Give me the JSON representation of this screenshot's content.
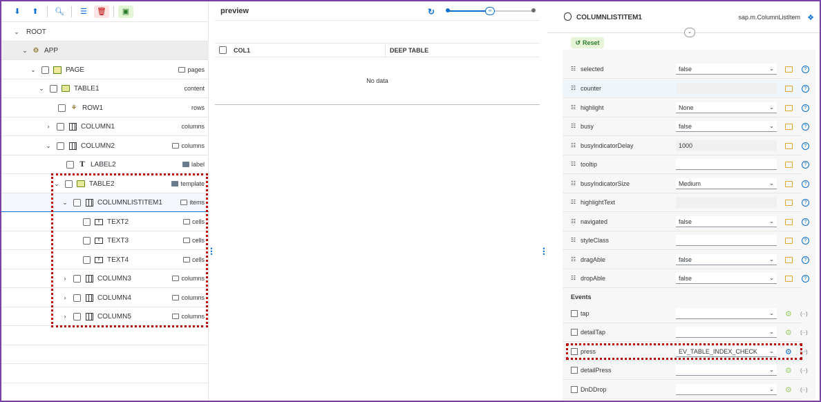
{
  "toolbar": {
    "icons": [
      "expand-all-icon",
      "collapse-all-icon",
      "search-icon",
      "tree-view-icon",
      "delete-icon",
      "add-screen-icon"
    ]
  },
  "tree": {
    "rows": [
      {
        "label": "ROOT",
        "agg": ""
      },
      {
        "label": "APP",
        "agg": ""
      },
      {
        "label": "PAGE",
        "agg": "pages"
      },
      {
        "label": "TABLE1",
        "agg": "content"
      },
      {
        "label": "ROW1",
        "agg": "rows"
      },
      {
        "label": "COLUMN1",
        "agg": "columns"
      },
      {
        "label": "COLUMN2",
        "agg": "columns"
      },
      {
        "label": "LABEL2",
        "agg": "label"
      },
      {
        "label": "TABLE2",
        "agg": "template"
      },
      {
        "label": "COLUMNLISTITEM1",
        "agg": "items"
      },
      {
        "label": "TEXT2",
        "agg": "cells"
      },
      {
        "label": "TEXT3",
        "agg": "cells"
      },
      {
        "label": "TEXT4",
        "agg": "cells"
      },
      {
        "label": "COLUMN3",
        "agg": "columns"
      },
      {
        "label": "COLUMN4",
        "agg": "columns"
      },
      {
        "label": "COLUMN5",
        "agg": "columns"
      }
    ]
  },
  "preview": {
    "title": "preview",
    "col1": "COL1",
    "col2": "DEEP TABLE",
    "nodata": "No data"
  },
  "props": {
    "title": "COLUMNLISTITEM1",
    "class": "sap.m.ColumnListItem",
    "reset": "Reset",
    "rows": [
      {
        "name": "selected",
        "value": "false",
        "kind": "select"
      },
      {
        "name": "counter",
        "value": "",
        "kind": "readonly"
      },
      {
        "name": "highlight",
        "value": "None",
        "kind": "select"
      },
      {
        "name": "busy",
        "value": "false",
        "kind": "select"
      },
      {
        "name": "busyIndicatorDelay",
        "value": "1000",
        "kind": "readonly"
      },
      {
        "name": "tooltip",
        "value": "",
        "kind": "input"
      },
      {
        "name": "busyIndicatorSize",
        "value": "Medium",
        "kind": "select"
      },
      {
        "name": "highlightText",
        "value": "",
        "kind": "readonly"
      },
      {
        "name": "navigated",
        "value": "false",
        "kind": "select"
      },
      {
        "name": "styleClass",
        "value": "",
        "kind": "input"
      },
      {
        "name": "dragAble",
        "value": "false",
        "kind": "select"
      },
      {
        "name": "dropAble",
        "value": "false",
        "kind": "select"
      }
    ],
    "events_heading": "Events",
    "events": [
      {
        "name": "tap",
        "value": ""
      },
      {
        "name": "detailTap",
        "value": ""
      },
      {
        "name": "press",
        "value": "EV_TABLE_INDEX_CHECK"
      },
      {
        "name": "detailPress",
        "value": ""
      },
      {
        "name": "DnDDrop",
        "value": ""
      }
    ]
  },
  "colors": {
    "accent": "#0a6ed1",
    "highlight_border": "#c00000",
    "frame": "#7b3fa8"
  }
}
